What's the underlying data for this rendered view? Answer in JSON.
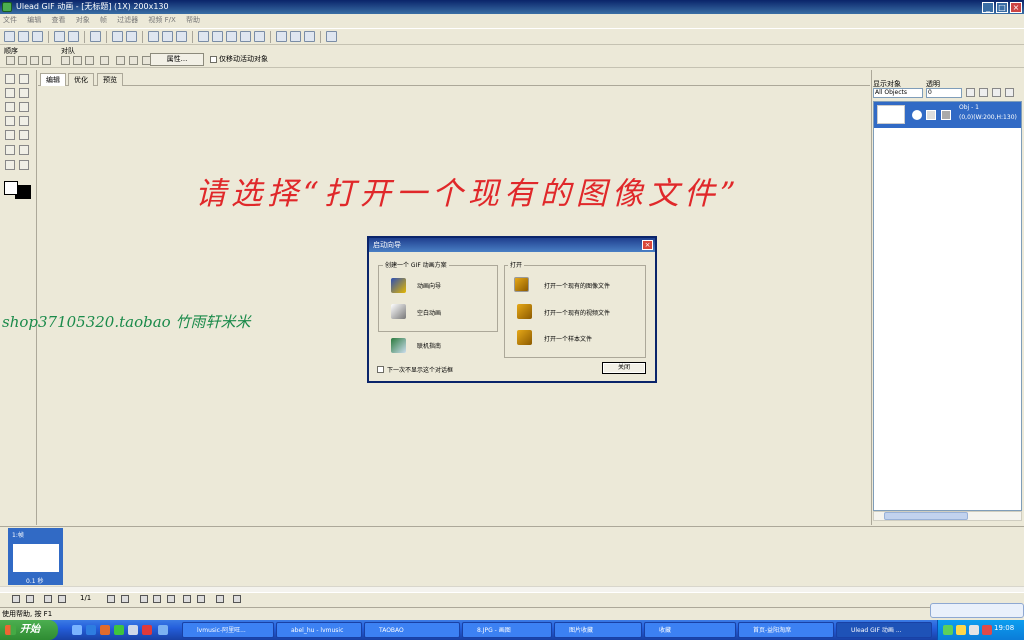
{
  "window": {
    "title": "Ulead GIF 动画 - [无标题] (1X) 200x130",
    "min": "_",
    "max": "□",
    "close": "×"
  },
  "menu": [
    "文件",
    "编辑",
    "查看",
    "对象",
    "帧",
    "过滤器",
    "视频 F/X",
    "帮助"
  ],
  "toolbar2": {
    "order_label": "顺序",
    "align_label": "对队",
    "props_button": "属性...",
    "only_drag_label": "仅移动活动对象"
  },
  "tabs": [
    "编辑",
    "优化",
    "预览"
  ],
  "overlay": {
    "prompt": "请选择“打开一个现有的图像文件”",
    "watermark": "shop37105320.taobao 竹雨轩米米"
  },
  "dialog": {
    "title": "启动向导",
    "create_group": "创建一个 GIF 动画方案",
    "create_items": [
      "动画向导",
      "空白动画"
    ],
    "online_help": "联机指南",
    "open_group": "打开",
    "open_items": [
      "打开一个现有的图像文件",
      "打开一个现有的视频文件",
      "打开一个样本文件"
    ],
    "dont_show": "下一次不显示这个对话框",
    "close_button": "关闭"
  },
  "right_panel": {
    "show_objects_label": "显示对象",
    "opacity_label": "透明",
    "objects_select": "All Objects",
    "opacity_value": "0",
    "object": {
      "name": "Obj - 1",
      "info": "(0,0)(W:200,H:130)"
    }
  },
  "frames": {
    "frame_label": "1:帧",
    "delay": "0.1 秒",
    "counter": "1/1"
  },
  "status": {
    "text": "使用帮助, 按 F1"
  },
  "taskbar": {
    "start": "开始",
    "tasks": [
      "lvmusic-阿里旺...",
      "abel_hu - lvmusic",
      "TAOBAO",
      "8.JPG - 画图",
      "图片收藏",
      "收藏",
      "首页-益阳淘席",
      "Ulead GIF 动画 ..."
    ],
    "clock": "19:08"
  },
  "colors": {
    "accent": "#0a246a",
    "overlay_red": "#e0282a",
    "watermark_green": "#1a8a4a",
    "selection": "#316ac5"
  }
}
